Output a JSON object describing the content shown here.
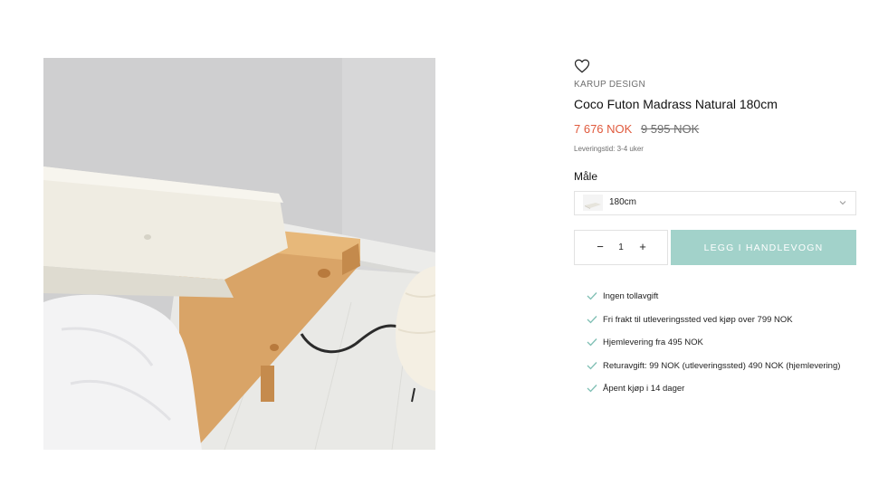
{
  "product": {
    "image_alt": "Coco Futon Madrass Natural 180cm",
    "brand": "KARUP DESIGN",
    "title": "Coco Futon Madrass Natural 180cm",
    "price_sale": "7 676 NOK",
    "price_original": "9 595 NOK",
    "delivery_time": "Leveringstid: 3-4 uker",
    "sale_color": "#e05a3d"
  },
  "variant": {
    "label": "Måle",
    "selected": "180cm"
  },
  "cart": {
    "quantity": "1",
    "minus_symbol": "−",
    "plus_symbol": "+",
    "add_label": "LEGG I HANDLEVOGN",
    "button_color": "#a2d2ca"
  },
  "usps": [
    "Ingen tollavgift",
    "Fri frakt til utleveringssted ved kjøp over 799 NOK",
    "Hjemlevering fra 495 NOK",
    "Returavgift: 99 NOK (utleveringssted) 490 NOK (hjemlevering)",
    "Åpent kjøp i 14 dager"
  ],
  "icons": {
    "wishlist": "heart-icon",
    "select": "chevron-down-icon",
    "usp": "check-icon"
  }
}
